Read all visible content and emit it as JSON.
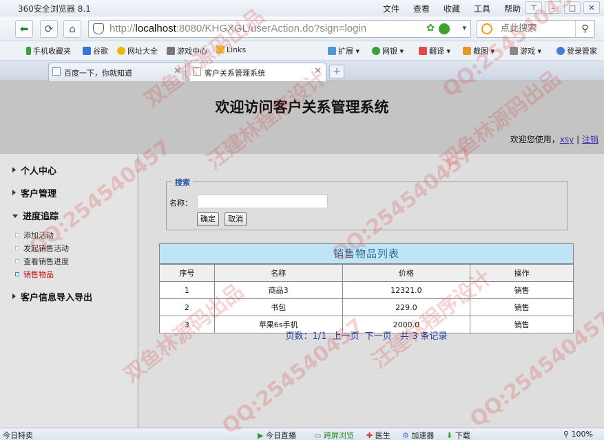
{
  "browser": {
    "title": "360安全浏览器 8.1",
    "menu": [
      "文件",
      "查看",
      "收藏",
      "工具",
      "帮助"
    ],
    "url_prefix": "http://",
    "url_host": "localhost",
    "url_rest": ":8080/KHGXGL/userAction.do?sign=login",
    "search_placeholder": "点此搜索",
    "favorites": [
      "手机收藏夹",
      "谷歌",
      "网址大全",
      "游戏中心",
      "Links",
      "扩展",
      "网银",
      "翻译",
      "截图",
      "游戏",
      "登录管家"
    ],
    "tabs": [
      {
        "label": "百度一下，你就知道",
        "active": false
      },
      {
        "label": "客户关系管理系统",
        "active": true
      }
    ],
    "status": {
      "left": "今日特卖",
      "items": [
        "今日直播",
        "跨屏浏览",
        "医生",
        "加速器",
        "下载"
      ],
      "zoom": "100%"
    }
  },
  "page": {
    "title": "欢迎访问客户关系管理系统",
    "welcome_prefix": "欢迎您使用，",
    "user": "xsy",
    "separator": "|",
    "logout": "注销"
  },
  "sidebar": {
    "groups": [
      {
        "label": "个人中心",
        "expanded": false
      },
      {
        "label": "客户管理",
        "expanded": false
      },
      {
        "label": "进度追踪",
        "expanded": true,
        "items": [
          {
            "label": "添加活动",
            "active": false
          },
          {
            "label": "发起销售活动",
            "active": false
          },
          {
            "label": "查看销售进度",
            "active": false
          },
          {
            "label": "销售物品",
            "active": true
          }
        ]
      },
      {
        "label": "客户信息导入导出",
        "expanded": false
      }
    ]
  },
  "search": {
    "legend": "搜索",
    "name_label": "名称：",
    "name_value": "",
    "confirm": "确定",
    "cancel": "取消"
  },
  "table": {
    "caption": "销售物品列表",
    "headers": [
      "序号",
      "名称",
      "价格",
      "操作"
    ],
    "rows": [
      {
        "no": "1",
        "name": "商品3",
        "price": "12321.0",
        "op": "销售"
      },
      {
        "no": "2",
        "name": "书包",
        "price": "229.0",
        "op": "销售"
      },
      {
        "no": "3",
        "name": "苹果6s手机",
        "price": "2000.0",
        "op": "销售"
      }
    ]
  },
  "pager": {
    "pages_label": "页数：",
    "pages": "1/1",
    "prev": "上一页",
    "next": "下一页",
    "total_prefix": "共",
    "total": "3",
    "total_suffix": "条记录"
  },
  "watermarks": [
    "QQ:254540457",
    "双鱼林源码出品",
    "汪建林程序设计"
  ]
}
